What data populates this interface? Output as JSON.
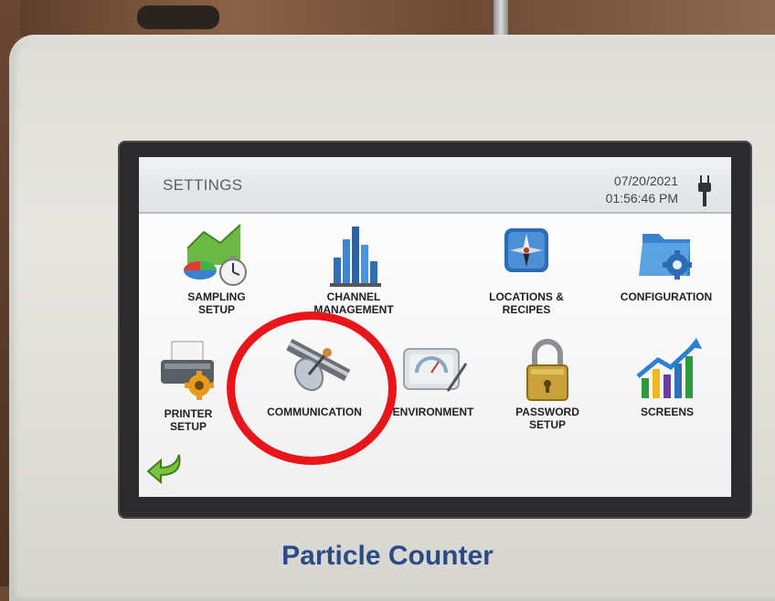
{
  "device": {
    "brand": "Particle Counter"
  },
  "header": {
    "title": "SETTINGS",
    "date": "07/20/2021",
    "time": "01:56:46 PM"
  },
  "tiles": [
    {
      "label": "SAMPLING\nSETUP"
    },
    {
      "label": "CHANNEL\nMANAGEMENT"
    },
    {
      "label": "LOCATIONS &\nRECIPES"
    },
    {
      "label": "CONFIGURATION"
    },
    {
      "label": "PRINTER\nSETUP"
    },
    {
      "label": "COMMUNICATION"
    },
    {
      "label": "ENVIRONMENT"
    },
    {
      "label": "PASSWORD\nSETUP"
    },
    {
      "label": "SCREENS"
    }
  ],
  "annotation": {
    "color": "#e8161a"
  }
}
